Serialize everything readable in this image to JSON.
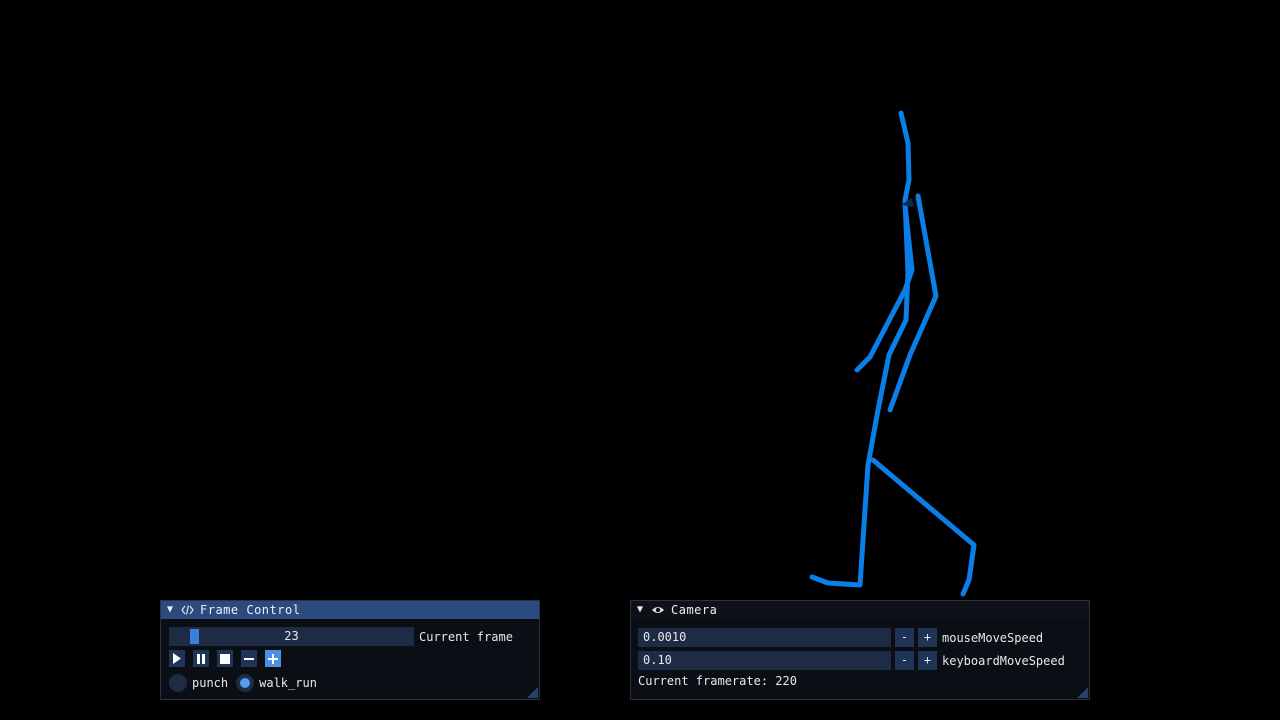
{
  "frame_control": {
    "title": "Frame Control",
    "current_frame_value": "23",
    "current_frame_label": "Current frame",
    "frame_slider_fraction": 0.09,
    "buttons": {
      "play": "play-icon",
      "pause": "pause-icon",
      "stop": "stop-icon",
      "prev": "minus-icon",
      "next": "plus-icon"
    },
    "animations": [
      {
        "label": "punch",
        "selected": false
      },
      {
        "label": "walk_run",
        "selected": true
      }
    ]
  },
  "camera": {
    "title": "Camera",
    "mouse_move_speed_value": "0.0010",
    "mouse_move_speed_label": "mouseMoveSpeed",
    "keyboard_move_speed_value": "0.10",
    "keyboard_move_speed_label": "keyboardMoveSpeed",
    "minus_label": "-",
    "plus_label": "+",
    "framerate_text": "Current framerate: 220"
  },
  "colors": {
    "skeleton": "#0b7fe8",
    "active_title": "#2b4a80",
    "accent": "#4b8fe6"
  }
}
